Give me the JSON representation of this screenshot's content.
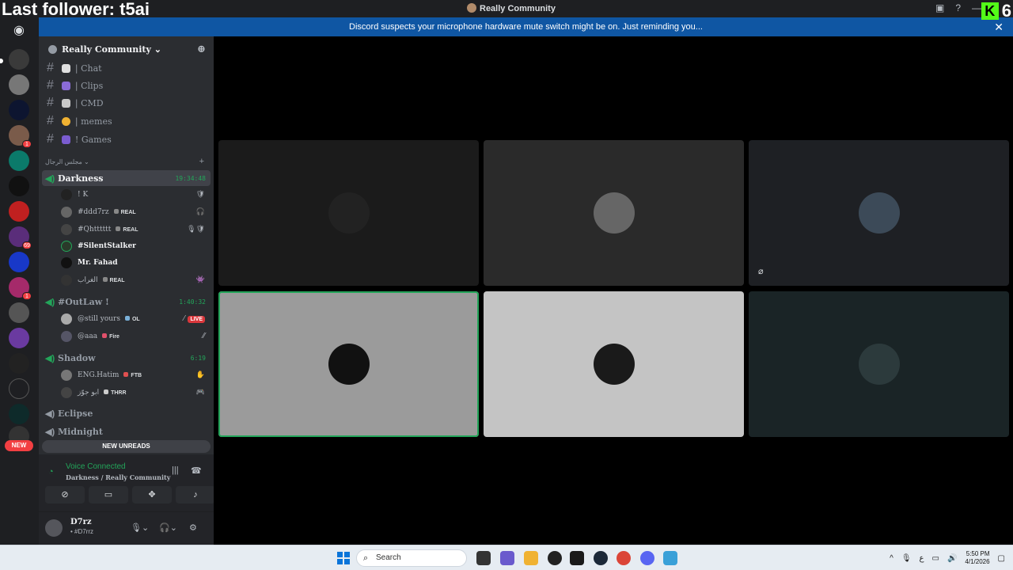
{
  "overlay": {
    "text": "Last follower: t5ai",
    "kick_count": "6",
    "kick_letter": "K"
  },
  "window": {
    "title": "Really Community"
  },
  "notice": {
    "text": "Discord suspects your microphone hardware mute switch might be on. Just reminding you...",
    "close": "✕"
  },
  "server": {
    "name": "Really Community ⌄"
  },
  "channels": [
    {
      "name": "| Chat",
      "emoji_color": "#e0e0e0"
    },
    {
      "name": "| Clips",
      "emoji_color": "#8a6bd6"
    },
    {
      "name": "| CMD",
      "emoji_color": "#c9c9c9"
    },
    {
      "name": "| memes",
      "emoji_color": "#f0b232"
    },
    {
      "name": "! Games",
      "emoji_color": "#7a5cd0"
    }
  ],
  "category": {
    "name": "مجلس الرجال ⌄",
    "plus": "+"
  },
  "voice_channels": {
    "darkness": {
      "name": "Darkness",
      "timer": "19:34:48"
    },
    "outlaw": {
      "name": "#OutLaw !",
      "timer": "1:40:32"
    },
    "shadow": {
      "name": "Shadow",
      "timer": "6:19"
    },
    "eclipse": {
      "name": "Eclipse"
    },
    "midnight": {
      "name": "Midnight"
    }
  },
  "darkness_members": [
    {
      "name": "! K",
      "tag": "",
      "right": "🛡"
    },
    {
      "name": "#ddd7rz",
      "tag": "REAL",
      "right": "🎧"
    },
    {
      "name": "#Qhtttttt",
      "tag": "REAL",
      "right": "🎙🛡"
    },
    {
      "name": "#SilentStalker",
      "tag": "",
      "right": ""
    },
    {
      "name": "Mr. Fahad",
      "tag": "",
      "right": ""
    },
    {
      "name": "الغراب",
      "tag": "REAL",
      "right": "👾"
    }
  ],
  "outlaw_members": [
    {
      "name": "@still yours",
      "tag": "OL",
      "live": "LIVE"
    },
    {
      "name": "@aaa",
      "tag": "Fire",
      "live": ""
    }
  ],
  "shadow_members": [
    {
      "name": "ENG.Hatim",
      "tag": "FTB"
    },
    {
      "name": "ابو جوّز",
      "tag": "THRR"
    }
  ],
  "unreads": "NEW UNREADS",
  "rail": {
    "new_label": "NEW",
    "badge_1": "1",
    "badge_69": "69"
  },
  "voice": {
    "status": "Voice Connected",
    "location": "Darkness / Really Community"
  },
  "user": {
    "name": "D7rz",
    "sub": "• #D7rrz"
  },
  "taskbar": {
    "search": "Search",
    "time": "5:50 PM",
    "date": "4/1/2026"
  },
  "colors": {
    "accent": "#23a55a",
    "notice": "#0f56a3",
    "danger": "#da373c"
  }
}
